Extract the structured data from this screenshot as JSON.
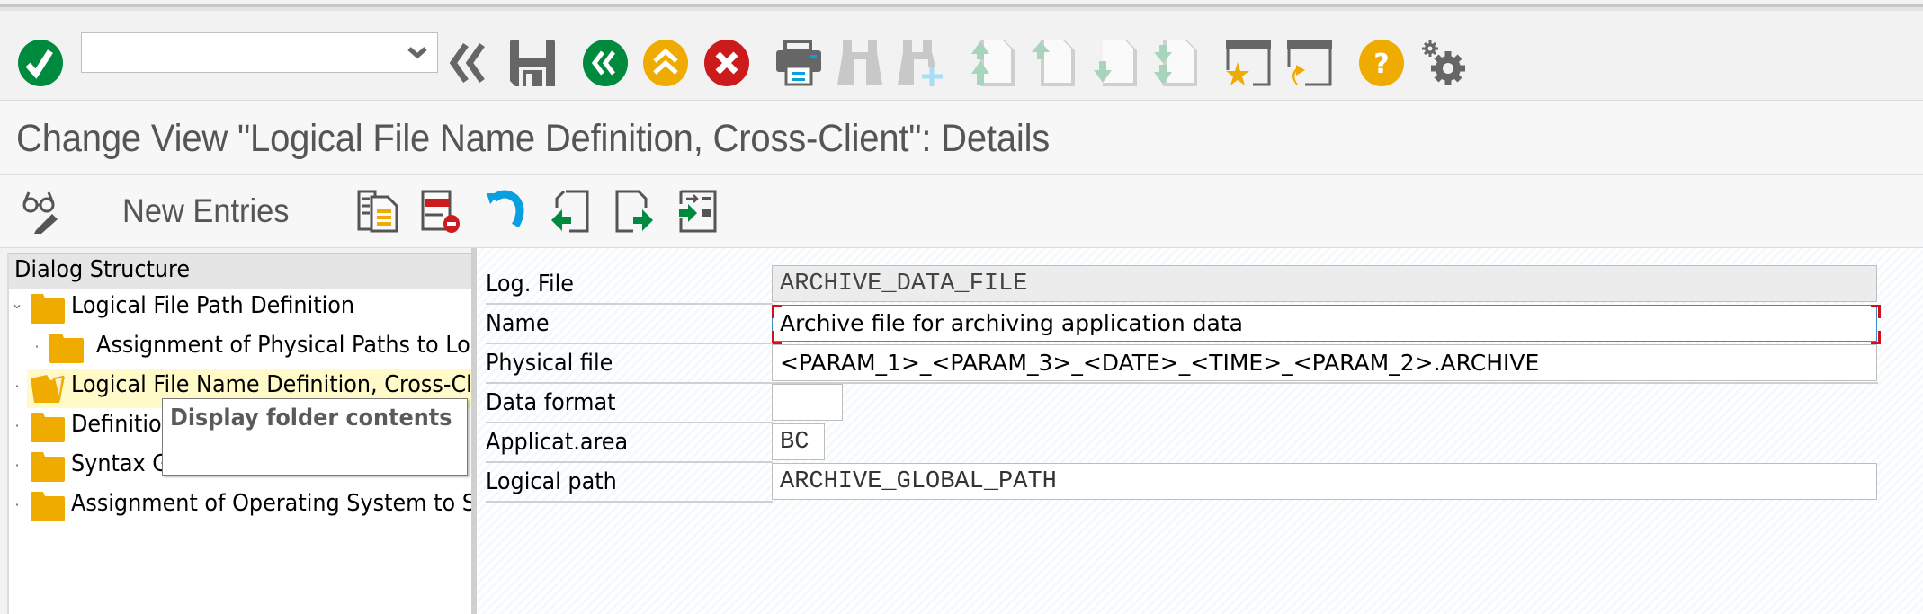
{
  "window": {
    "title": "Change View \"Logical File Name Definition, Cross-Client\": Details"
  },
  "system_toolbar": {
    "command_field": {
      "value": "",
      "placeholder": ""
    },
    "buttons": [
      {
        "name": "enter",
        "icon": "check-circle-icon",
        "color": "#008a3e"
      },
      {
        "name": "collapse-command-field",
        "icon": "double-chevron-left-icon",
        "color": "#666666"
      },
      {
        "name": "save",
        "icon": "floppy-disk-icon",
        "color": "#666666"
      },
      {
        "name": "back",
        "icon": "back-circle-icon",
        "color": "#008a3e"
      },
      {
        "name": "exit",
        "icon": "exit-circle-icon",
        "color": "#f0ab00"
      },
      {
        "name": "cancel",
        "icon": "cancel-circle-icon",
        "color": "#cc1b1c"
      },
      {
        "name": "print",
        "icon": "printer-icon",
        "color": "#666666"
      },
      {
        "name": "find",
        "icon": "binoculars-icon",
        "color": "#c8c8c8",
        "disabled": true
      },
      {
        "name": "find-next",
        "icon": "binoculars-plus-icon",
        "color": "#c8c8c8",
        "disabled": true
      },
      {
        "name": "first-page",
        "icon": "first-page-icon",
        "color": "#a9d4bc",
        "disabled": true
      },
      {
        "name": "previous-page",
        "icon": "previous-page-icon",
        "color": "#a9d4bc",
        "disabled": true
      },
      {
        "name": "next-page",
        "icon": "next-page-icon",
        "color": "#a9d4bc",
        "disabled": true
      },
      {
        "name": "last-page",
        "icon": "last-page-icon",
        "color": "#a9d4bc",
        "disabled": true
      },
      {
        "name": "create-session",
        "icon": "window-star-icon",
        "color": "#f0ab00"
      },
      {
        "name": "create-shortcut",
        "icon": "window-shortcut-icon",
        "color": "#f0ab00"
      },
      {
        "name": "help",
        "icon": "help-circle-icon",
        "color": "#f0ab00"
      },
      {
        "name": "customize-layout",
        "icon": "gears-icon",
        "color": "#666666"
      }
    ]
  },
  "application_toolbar": {
    "display_change_icon": "glasses-pencil-icon",
    "new_entries_label": "New Entries",
    "buttons": [
      {
        "name": "copy-as",
        "icon": "copy-doc-icon"
      },
      {
        "name": "delete",
        "icon": "delete-row-icon"
      },
      {
        "name": "undo-change",
        "icon": "undo-icon"
      },
      {
        "name": "previous-entry",
        "icon": "previous-entry-icon"
      },
      {
        "name": "next-entry",
        "icon": "next-entry-icon"
      },
      {
        "name": "select-entries",
        "icon": "select-entries-icon"
      }
    ]
  },
  "dialog_structure": {
    "header": "Dialog Structure",
    "items": [
      {
        "label": "Logical File Path Definition",
        "level": 0,
        "toggle": "expanded",
        "selected": false,
        "folder": "closed"
      },
      {
        "label": "Assignment of Physical Paths to Logical Path",
        "level": 1,
        "toggle": "leaf",
        "selected": false,
        "folder": "closed"
      },
      {
        "label": "Logical File Name Definition, Cross-Client",
        "level": 0,
        "toggle": "leaf",
        "selected": true,
        "folder": "open"
      },
      {
        "label": "Definition of Variables",
        "level": 0,
        "toggle": "leaf",
        "selected": false,
        "folder": "closed"
      },
      {
        "label": "Syntax Group Definition",
        "level": 0,
        "toggle": "leaf",
        "selected": false,
        "folder": "closed"
      },
      {
        "label": "Assignment of Operating System to Syntax Group",
        "level": 0,
        "toggle": "leaf",
        "selected": false,
        "folder": "closed"
      }
    ],
    "tooltip": "Display folder contents"
  },
  "details_form": {
    "fields": [
      {
        "label": "Log. File",
        "value": "ARCHIVE_DATA_FILE",
        "readonly": true,
        "font": "mono"
      },
      {
        "label": "Name",
        "value": "Archive file for archiving application data",
        "readonly": false,
        "focused": true,
        "font": "sans"
      },
      {
        "label": "Physical file",
        "value": "<PARAM_1>_<PARAM_3>_<DATE>_<TIME>_<PARAM_2>.ARCHIVE",
        "readonly": false,
        "font": "sans"
      },
      {
        "label": "Data format",
        "value": "",
        "readonly": false,
        "font": "mono"
      },
      {
        "label": "Applicat.area",
        "value": "BC",
        "readonly": false,
        "font": "mono"
      },
      {
        "label": "Logical path",
        "value": "ARCHIVE_GLOBAL_PATH",
        "readonly": false,
        "font": "mono"
      }
    ]
  },
  "colors": {
    "accent_green": "#008a3e",
    "accent_yellow": "#f0ab00",
    "accent_red": "#cc1b1c",
    "icon_gray": "#666666",
    "folder": "#f0ab00",
    "selection_bg": "#fffac8",
    "focus_border": "#3a8fc9"
  }
}
